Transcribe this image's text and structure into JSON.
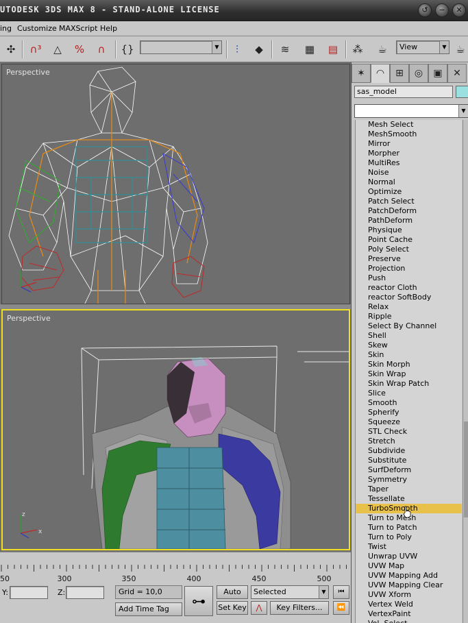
{
  "window": {
    "title": "UTODESK 3DS MAX 8  - STAND-ALONE LICENSE",
    "buttons": [
      "↺",
      "−",
      "✕"
    ]
  },
  "menu": {
    "items": [
      "ing",
      "Customize",
      "MAXScript",
      "Help"
    ]
  },
  "toolbar": {
    "named_selection_value": "",
    "view_combo_value": "View"
  },
  "viewports": {
    "top_label": "Perspective",
    "bottom_label": "Perspective",
    "axis_x": "x",
    "axis_z": "z"
  },
  "command_panel": {
    "object_name": "sas_model",
    "modifier_list_value": "",
    "modifiers": [
      "Mesh Select",
      "MeshSmooth",
      "Mirror",
      "Morpher",
      "MultiRes",
      "Noise",
      "Normal",
      "Optimize",
      "Patch Select",
      "PatchDeform",
      "PathDeform",
      "Physique",
      "Point Cache",
      "Poly Select",
      "Preserve",
      "Projection",
      "Push",
      "reactor Cloth",
      "reactor SoftBody",
      "Relax",
      "Ripple",
      "Select By Channel",
      "Shell",
      "Skew",
      "Skin",
      "Skin Morph",
      "Skin Wrap",
      "Skin Wrap Patch",
      "Slice",
      "Smooth",
      "Spherify",
      "Squeeze",
      "STL Check",
      "Stretch",
      "Subdivide",
      "Substitute",
      "SurfDeform",
      "Symmetry",
      "Taper",
      "Tessellate",
      "TurboSmooth",
      "Turn to Mesh",
      "Turn to Patch",
      "Turn to Poly",
      "Twist",
      "Unwrap UVW",
      "UVW Map",
      "UVW Mapping Add",
      "UVW Mapping Clear",
      "UVW Xform",
      "Vertex Weld",
      "VertexPaint",
      "Vol. Select"
    ],
    "selected_modifier": "TurboSmooth"
  },
  "timeline": {
    "ticks": [
      "50",
      "300",
      "350",
      "400",
      "450",
      "500"
    ]
  },
  "status": {
    "y_label": "Y:",
    "z_label": "Z:",
    "grid": "Grid = 10,0",
    "add_time_tag": "Add Time Tag",
    "auto_key": "Auto Key",
    "set_key": "Set Key",
    "selected": "Selected",
    "key_filters": "Key Filters..."
  },
  "colors": {
    "selected_highlight": "#e8c14a",
    "active_viewport_border": "#f0e020",
    "object_color_swatch": "#9ae0e0"
  }
}
